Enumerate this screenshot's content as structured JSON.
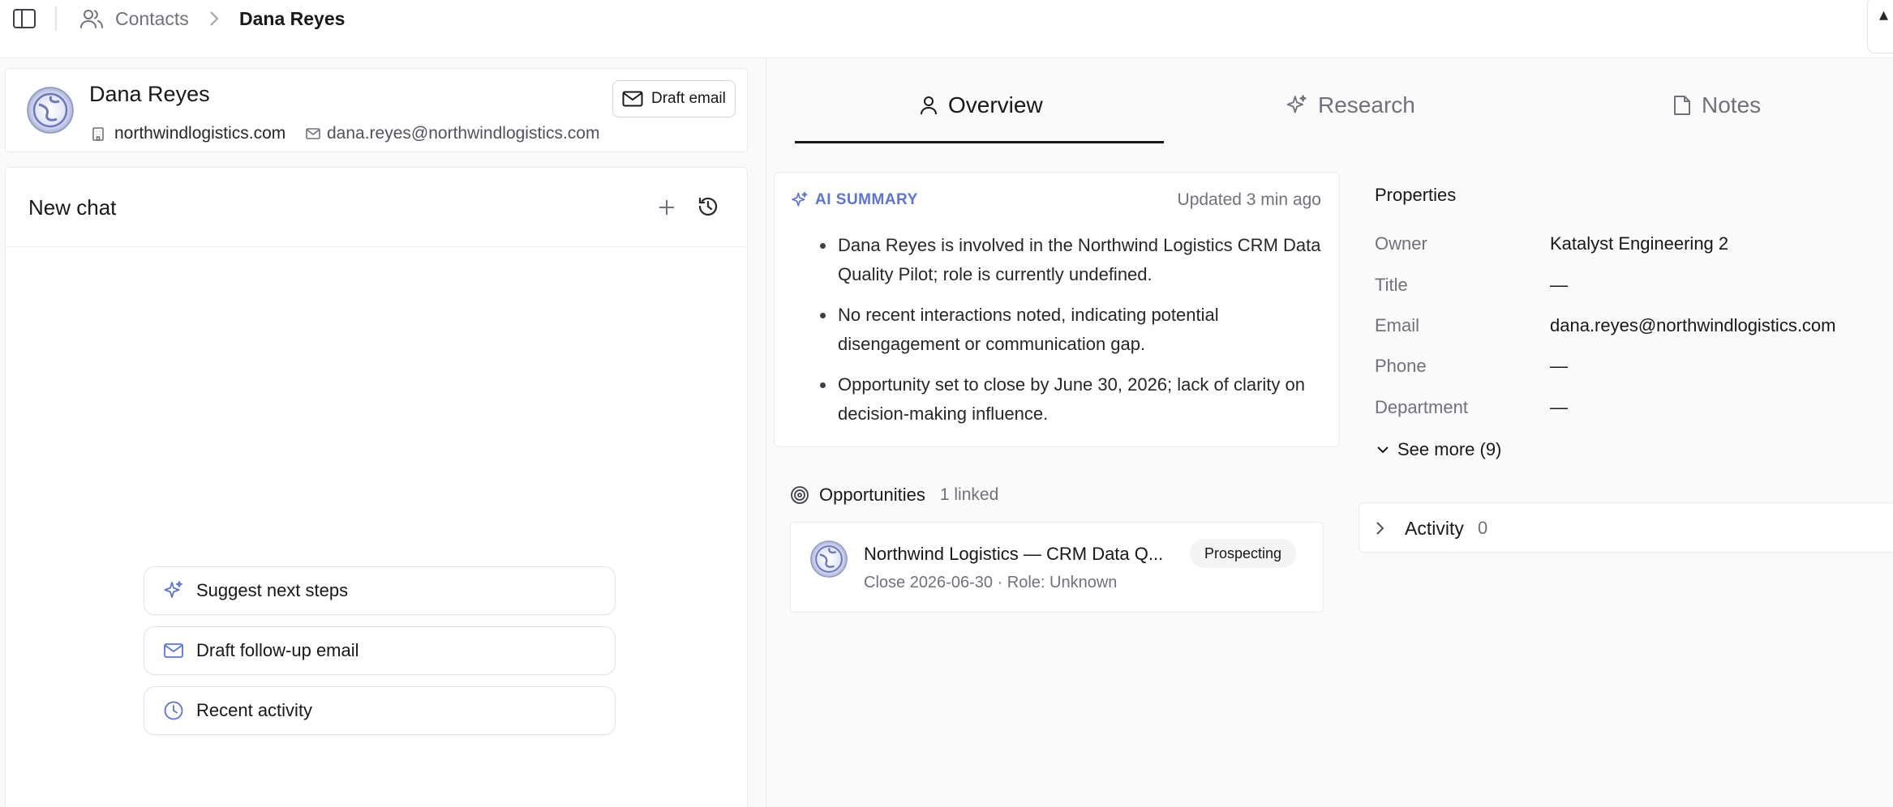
{
  "breadcrumb": {
    "contacts_label": "Contacts",
    "current_label": "Dana Reyes"
  },
  "contact": {
    "name": "Dana Reyes",
    "domain": "northwindlogistics.com",
    "email": "dana.reyes@northwindlogistics.com",
    "draft_email_label": "Draft email"
  },
  "chat": {
    "title": "New chat",
    "suggestions": [
      {
        "label": "Suggest next steps",
        "icon": "sparkles-icon"
      },
      {
        "label": "Draft follow-up email",
        "icon": "mail-icon"
      },
      {
        "label": "Recent activity",
        "icon": "clock-icon"
      }
    ]
  },
  "tabs": [
    {
      "label": "Overview",
      "icon": "user-icon",
      "active": true
    },
    {
      "label": "Research",
      "icon": "sparkles-icon",
      "active": false
    },
    {
      "label": "Notes",
      "icon": "file-icon",
      "active": false
    }
  ],
  "ai_summary": {
    "label": "AI SUMMARY",
    "updated": "Updated 3 min ago",
    "bullets": [
      "Dana Reyes is involved in the Northwind Logistics CRM Data Quality Pilot; role is currently undefined.",
      "No recent interactions noted, indicating potential disengagement or communication gap.",
      "Opportunity set to close by June 30, 2026; lack of clarity on decision-making influence."
    ]
  },
  "opportunities": {
    "title": "Opportunities",
    "count_label": "1 linked",
    "items": [
      {
        "name": "Northwind Logistics — CRM Data Q...",
        "stage": "Prospecting",
        "meta": "Close 2026-06-30 · Role: Unknown"
      }
    ]
  },
  "properties": {
    "title": "Properties",
    "rows": [
      {
        "key": "Owner",
        "value": "Katalyst Engineering 2"
      },
      {
        "key": "Title",
        "value": "—"
      },
      {
        "key": "Email",
        "value": "dana.reyes@northwindlogistics.com"
      },
      {
        "key": "Phone",
        "value": "—"
      },
      {
        "key": "Department",
        "value": "—"
      }
    ],
    "see_more_label": "See more (9)"
  },
  "activity": {
    "label": "Activity",
    "count": "0"
  },
  "colors": {
    "accent": "#5b74d6",
    "text": "#18181b",
    "muted": "#71717a",
    "border": "#ececef"
  }
}
